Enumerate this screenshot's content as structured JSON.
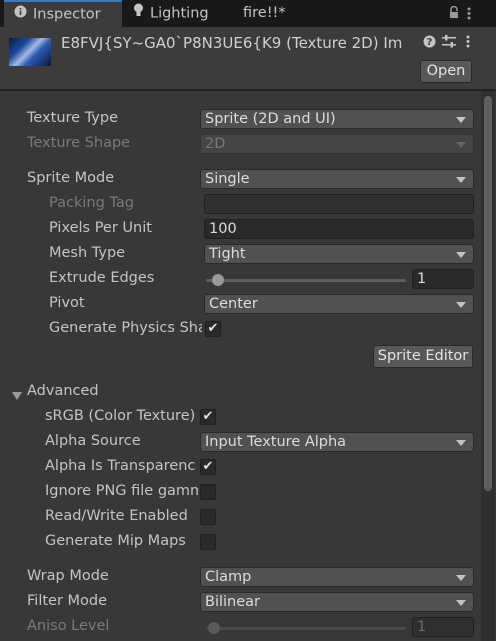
{
  "tabs": [
    {
      "label": "Inspector",
      "icon": "info-icon"
    },
    {
      "label": "Lighting",
      "icon": "light-bulb-icon"
    },
    {
      "label": "fire!!*"
    }
  ],
  "header": {
    "title": "E8FVJ{SY~GA0`P8N3UE6{K9 (Texture 2D) Im",
    "open_label": "Open"
  },
  "props": {
    "texture_type": {
      "label": "Texture Type",
      "value": "Sprite (2D and UI)"
    },
    "texture_shape": {
      "label": "Texture Shape",
      "value": "2D"
    },
    "sprite_mode": {
      "label": "Sprite Mode",
      "value": "Single"
    },
    "packing_tag": {
      "label": "Packing Tag",
      "value": ""
    },
    "pixels_per_unit": {
      "label": "Pixels Per Unit",
      "value": "100"
    },
    "mesh_type": {
      "label": "Mesh Type",
      "value": "Tight"
    },
    "extrude_edges": {
      "label": "Extrude Edges",
      "value": "1",
      "slider_fraction": 0.02
    },
    "pivot": {
      "label": "Pivot",
      "value": "Center"
    },
    "generate_physics_shape": {
      "label": "Generate Physics Sha",
      "checked": true
    },
    "sprite_editor_label": "Sprite Editor"
  },
  "advanced": {
    "section_label": "Advanced",
    "srgb": {
      "label": "sRGB (Color Texture)",
      "checked": true
    },
    "alpha_source": {
      "label": "Alpha Source",
      "value": "Input Texture Alpha"
    },
    "alpha_is_transparency": {
      "label": "Alpha Is Transparenc",
      "checked": true
    },
    "ignore_png_gamma": {
      "label": "Ignore PNG file gamm",
      "checked": false
    },
    "read_write": {
      "label": "Read/Write Enabled",
      "checked": false
    },
    "generate_mip_maps": {
      "label": "Generate Mip Maps",
      "checked": false
    }
  },
  "bottom": {
    "wrap_mode": {
      "label": "Wrap Mode",
      "value": "Clamp"
    },
    "filter_mode": {
      "label": "Filter Mode",
      "value": "Bilinear"
    },
    "aniso_level": {
      "label": "Aniso Level",
      "value": "1",
      "slider_fraction": 0.0
    }
  },
  "colors": {
    "accent": "#3a79bb",
    "background": "#383838",
    "header": "#3c3c3c",
    "tabbar": "#191919"
  }
}
